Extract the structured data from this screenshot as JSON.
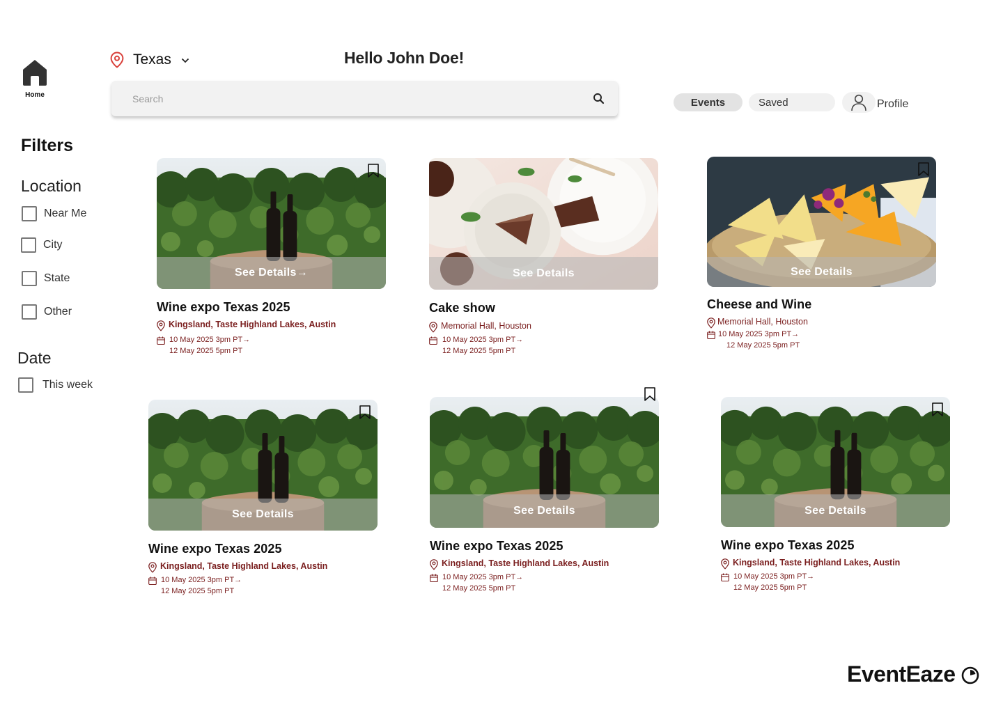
{
  "nav": {
    "home_label": "Home"
  },
  "header": {
    "location": "Texas",
    "greeting": "Hello John Doe!",
    "search_placeholder": "Search",
    "tabs": {
      "events": "Events",
      "saved": "Saved",
      "profile": "Profile"
    }
  },
  "filters": {
    "title": "Filters",
    "location": {
      "title": "Location",
      "options": [
        "Near Me",
        "City",
        "State",
        "Other"
      ]
    },
    "date": {
      "title": "Date",
      "options": [
        "This week"
      ]
    }
  },
  "events": [
    {
      "title": "Wine expo Texas 2025",
      "location": "Kingsland, Taste Highland Lakes, Austin",
      "date_start": "10 May 2025 3pm PT→",
      "date_end": "12 May 2025 5pm PT",
      "details_label": "See Details→",
      "image": "wine-bottles-on-barrel",
      "saved": false
    },
    {
      "title": "Cake show",
      "location": "Memorial Hall, Houston",
      "date_start": "10 May 2025 3pm PT→",
      "date_end": "12 May 2025 5pm PT",
      "details_label": "See Details",
      "image": "chocolate-cake-slices",
      "saved": false
    },
    {
      "title": "Cheese and Wine",
      "location": "Memorial Hall, Houston",
      "date_start": "10 May 2025 3pm PT→",
      "date_end": "12 May 2025 5pm PT",
      "details_label": "See Details",
      "image": "cheese-platter",
      "saved": false
    },
    {
      "title": "Wine expo Texas 2025",
      "location": "Kingsland, Taste Highland Lakes, Austin",
      "date_start": "10 May 2025 3pm PT→",
      "date_end": "12 May 2025 5pm PT",
      "details_label": "See Details",
      "image": "wine-bottles-on-barrel",
      "saved": false
    },
    {
      "title": "Wine expo Texas 2025",
      "location": "Kingsland, Taste Highland Lakes, Austin",
      "date_start": "10 May 2025 3pm PT→",
      "date_end": "12 May 2025 5pm PT",
      "details_label": "See Details",
      "image": "wine-bottles-on-barrel",
      "saved": false
    },
    {
      "title": "Wine expo Texas 2025",
      "location": "Kingsland, Taste Highland Lakes, Austin",
      "date_start": "10 May 2025 3pm PT→",
      "date_end": "12 May 2025 5pm PT",
      "details_label": "See Details",
      "image": "wine-bottles-on-barrel",
      "saved": false
    }
  ],
  "brand": {
    "name": "EventEaze"
  },
  "colors": {
    "accent": "#7a1e1e",
    "pin": "#d9413b",
    "pill": "#e3e3e3"
  }
}
